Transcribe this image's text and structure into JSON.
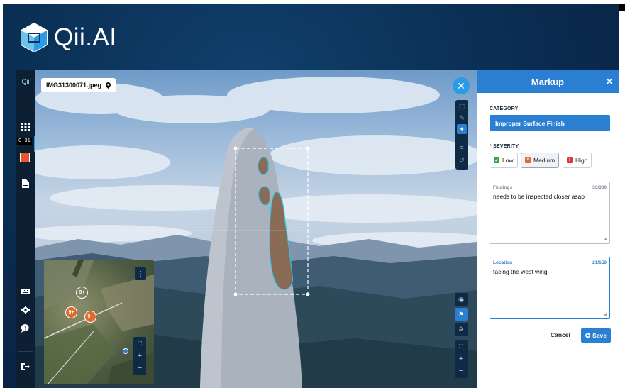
{
  "brand": {
    "logo_text": "Qii",
    "logo_suffix": ".AI"
  },
  "sidebar": {
    "logo_glyph": "Qii",
    "timer": "0:31",
    "icons": [
      "grid-icon",
      "record-icon",
      "file-icon",
      "keyboard-icon",
      "gear-icon",
      "feedback-icon",
      "logout-icon"
    ]
  },
  "viewer": {
    "file_name": "IMG31300071.jpeg",
    "minimap_clusters": [
      {
        "label": "9+",
        "color": "#3aa64a"
      },
      {
        "label": "9+",
        "color": "#e0692d"
      },
      {
        "label": "9+",
        "color": "#e0692d"
      }
    ]
  },
  "panel": {
    "title": "Markup",
    "category_label": "CATEGORY",
    "category_value": "Improper Surface Finish",
    "severity_label": "SEVERITY",
    "severity_required_mark": "*",
    "severity_options": [
      {
        "label": "Low",
        "color": "#3aa64a",
        "selected": false
      },
      {
        "label": "Medium",
        "color": "#e0692d",
        "selected": true
      },
      {
        "label": "High",
        "color": "#d63c3c",
        "selected": false
      }
    ],
    "findings": {
      "label": "Findings",
      "count": "33/300",
      "value": "needs to be inspected closer asap"
    },
    "location": {
      "label": "Location",
      "count": "21/150",
      "value": "facing the west wing"
    },
    "cancel_label": "Cancel",
    "save_label": "Save"
  }
}
